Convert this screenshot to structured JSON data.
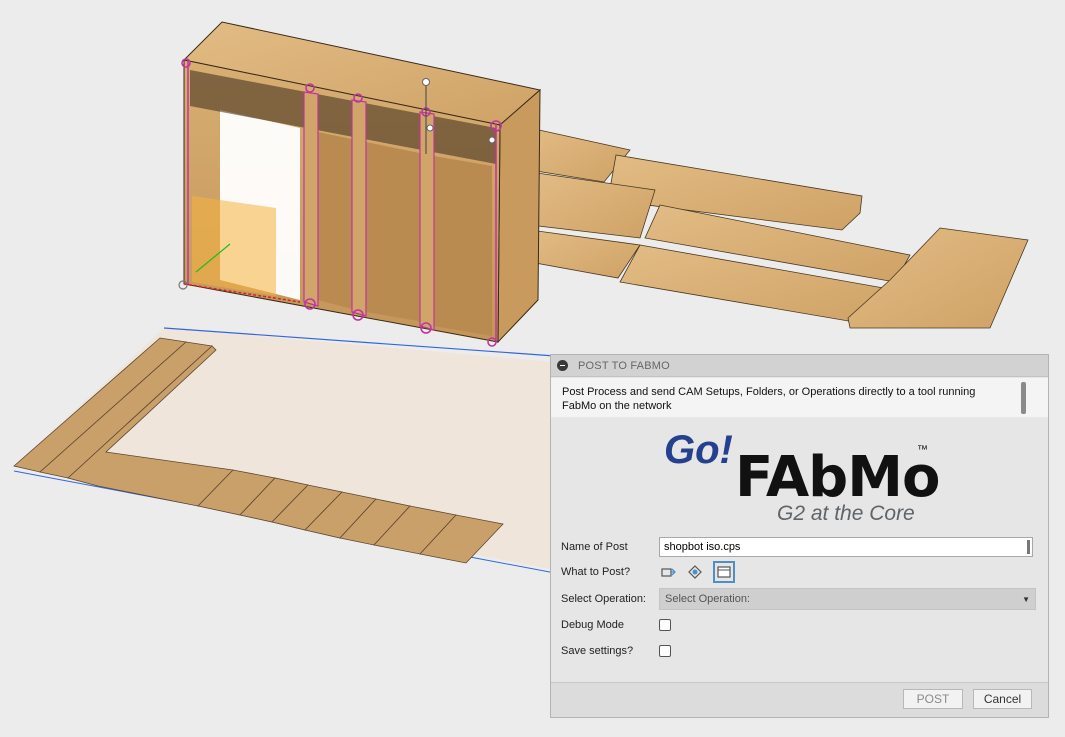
{
  "dialog": {
    "title": "POST TO FABMO",
    "description": "Post Process and send CAM Setups, Folders, or Operations directly to a tool running FabMo on the network",
    "logo": {
      "go_text": "Go!",
      "brand_text": "FAbMo",
      "trademark": "™",
      "tagline": "G2 at the Core"
    },
    "fields": {
      "name_of_post": {
        "label": "Name of Post",
        "value": "shopbot iso.cps"
      },
      "what_to_post": {
        "label": "What to Post?",
        "options": [
          "setup-icon",
          "folder-icon",
          "operation-icon"
        ],
        "selected": "operation-icon"
      },
      "select_operation": {
        "label": "Select Operation:",
        "value": "Select Operation:"
      },
      "debug_mode": {
        "label": "Debug Mode",
        "checked": false
      },
      "save_settings": {
        "label": "Save settings?",
        "checked": false
      }
    },
    "buttons": {
      "post": "POST",
      "cancel": "Cancel"
    }
  },
  "colors": {
    "accent": "#4f8fc8",
    "logo_blue": "#24408e",
    "logo_grey": "#5f6469",
    "wood": "#d9b078",
    "sketch_plane": "#efe5db",
    "constraint": "#c0359d"
  }
}
